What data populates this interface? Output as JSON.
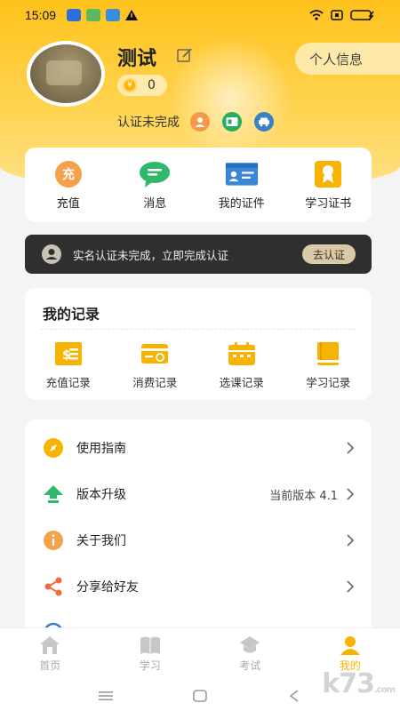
{
  "status_bar": {
    "time": "15:09"
  },
  "profile": {
    "name": "测试",
    "coins": "0",
    "coin_symbol": "¥",
    "profile_button": "个人信息",
    "verify_status": "认证未完成"
  },
  "quick_actions": [
    {
      "label": "充值",
      "icon": "recharge-icon",
      "glyph": "充"
    },
    {
      "label": "消息",
      "icon": "message-icon"
    },
    {
      "label": "我的证件",
      "icon": "id-card-icon"
    },
    {
      "label": "学习证书",
      "icon": "certificate-icon"
    }
  ],
  "notice": {
    "text": "实名认证未完成，立即完成认证",
    "button": "去认证"
  },
  "records": {
    "title": "我的记录",
    "items": [
      {
        "label": "充值记录",
        "icon": "recharge-record-icon"
      },
      {
        "label": "消费记录",
        "icon": "consume-record-icon"
      },
      {
        "label": "选课记录",
        "icon": "course-record-icon"
      },
      {
        "label": "学习记录",
        "icon": "study-record-icon"
      }
    ]
  },
  "menu": [
    {
      "label": "使用指南",
      "icon": "compass-icon",
      "extra": ""
    },
    {
      "label": "版本升级",
      "icon": "upgrade-icon",
      "extra": "当前版本 4.1"
    },
    {
      "label": "关于我们",
      "icon": "info-icon",
      "extra": ""
    },
    {
      "label": "分享给好友",
      "icon": "share-icon",
      "extra": ""
    }
  ],
  "tabs": [
    {
      "label": "首页",
      "icon": "home-icon",
      "active": false
    },
    {
      "label": "学习",
      "icon": "book-icon",
      "active": false
    },
    {
      "label": "考试",
      "icon": "exam-icon",
      "active": false
    },
    {
      "label": "我的",
      "icon": "profile-icon",
      "active": true
    }
  ],
  "watermark": "k73",
  "watermark_suffix": ".com",
  "colors": {
    "accent": "#f6b300",
    "header": "#ffc21c",
    "notice_bg": "#2f2f2f"
  }
}
